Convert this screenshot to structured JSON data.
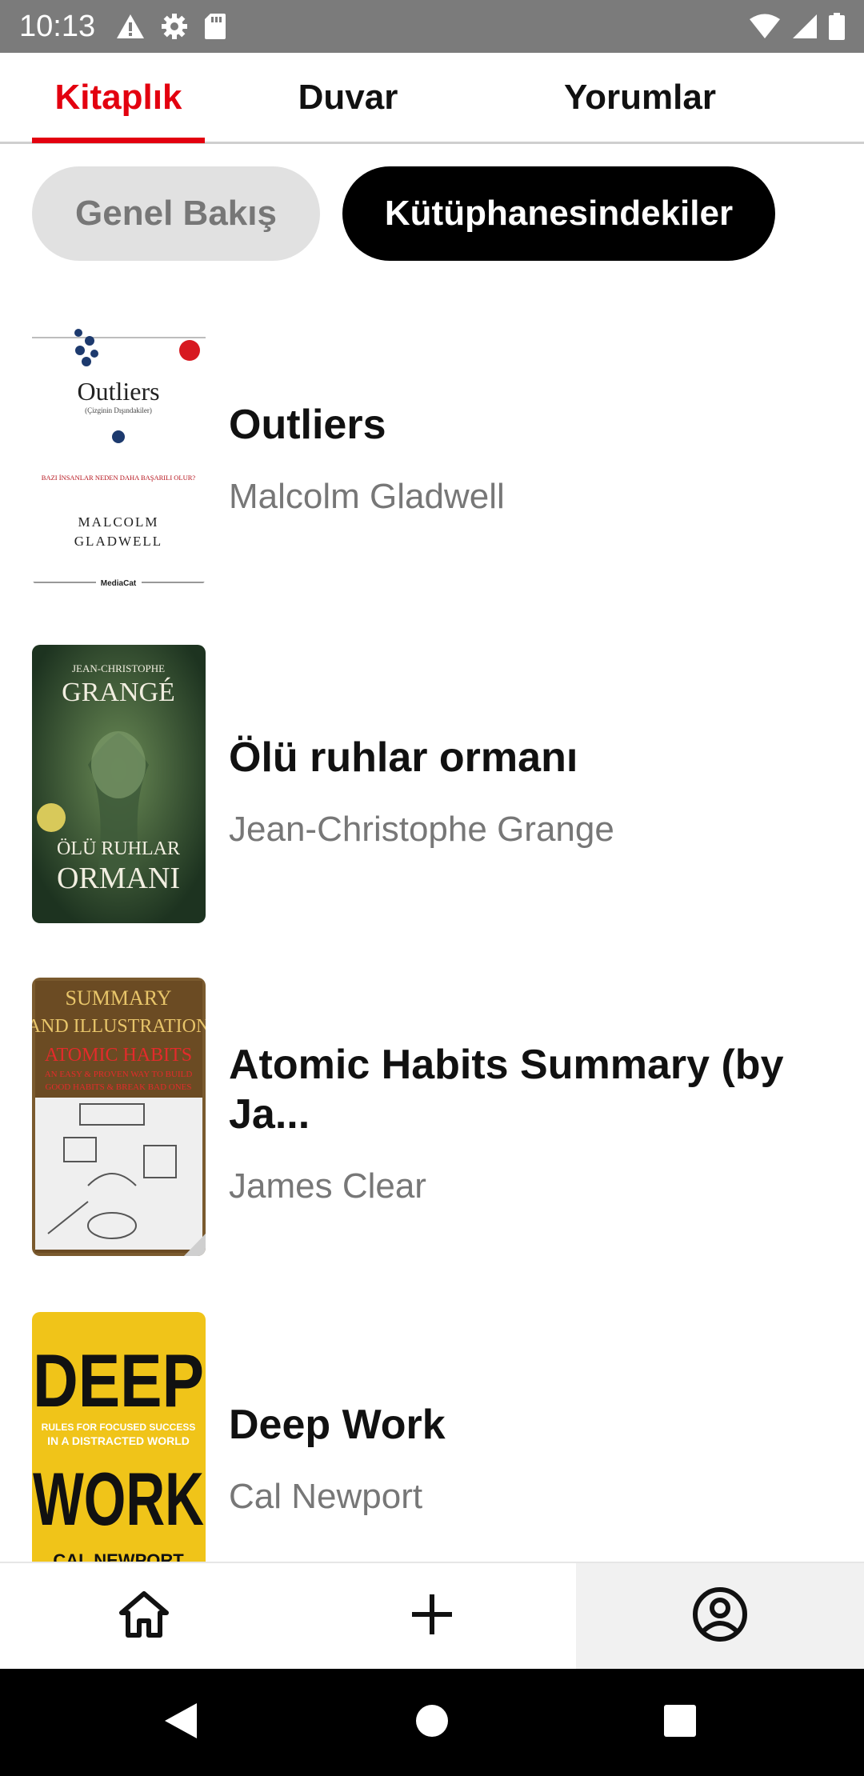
{
  "status_bar": {
    "time": "10:13",
    "left_icons": [
      "warning-icon",
      "gear-icon",
      "sd-card-icon"
    ],
    "right_icons": [
      "wifi-icon",
      "signal-icon",
      "battery-icon"
    ]
  },
  "tabs": [
    {
      "label": "Kitaplık",
      "active": true
    },
    {
      "label": "Duvar",
      "active": false
    },
    {
      "label": "Yorumlar",
      "active": false
    }
  ],
  "chips": [
    {
      "label": "Genel Bakış",
      "selected": false
    },
    {
      "label": "Kütüphanesindekiler",
      "selected": true
    }
  ],
  "books": [
    {
      "title": "Outliers",
      "author": "Malcolm Gladwell",
      "cover_text": [
        "Outliers",
        "(Çizginin Dışındakiler)",
        "BAZI İNSANLAR NEDEN DAHA BAŞARILI OLUR?",
        "MALCOLM",
        "GLADWELL",
        "MediaCat"
      ]
    },
    {
      "title": "Ölü ruhlar ormanı",
      "author": "Jean-Christophe Grange",
      "cover_text": [
        "JEAN-CHRISTOPHE",
        "GRANGÉ",
        "ÖLÜ RUHLAR",
        "ORMANI"
      ]
    },
    {
      "title": "Atomic Habits Summary (by Ja...",
      "author": "James Clear",
      "cover_text": [
        "SUMMARY",
        "AND ILLUSTRATION",
        "ATOMIC HABITS",
        "AN EASY & PROVEN WAY TO BUILD",
        "GOOD HABITS & BREAK BAD ONES"
      ]
    },
    {
      "title": "Deep Work",
      "author": "Cal Newport",
      "cover_text": [
        "DEEP",
        "RULES FOR FOCUSED SUCCESS",
        "IN A DISTRACTED WORLD",
        "WORK",
        "CAL NEWPORT"
      ]
    }
  ],
  "bottom_nav": [
    {
      "icon": "home-icon",
      "selected": false
    },
    {
      "icon": "plus-icon",
      "selected": false
    },
    {
      "icon": "profile-icon",
      "selected": true
    }
  ],
  "system_nav": [
    "back-icon",
    "home-circle-icon",
    "recents-icon"
  ],
  "colors": {
    "accent": "#e3000f",
    "chip_selected_bg": "#000000",
    "chip_unselected_bg": "#e1e1e1",
    "status_bar": "#7b7b7b"
  }
}
